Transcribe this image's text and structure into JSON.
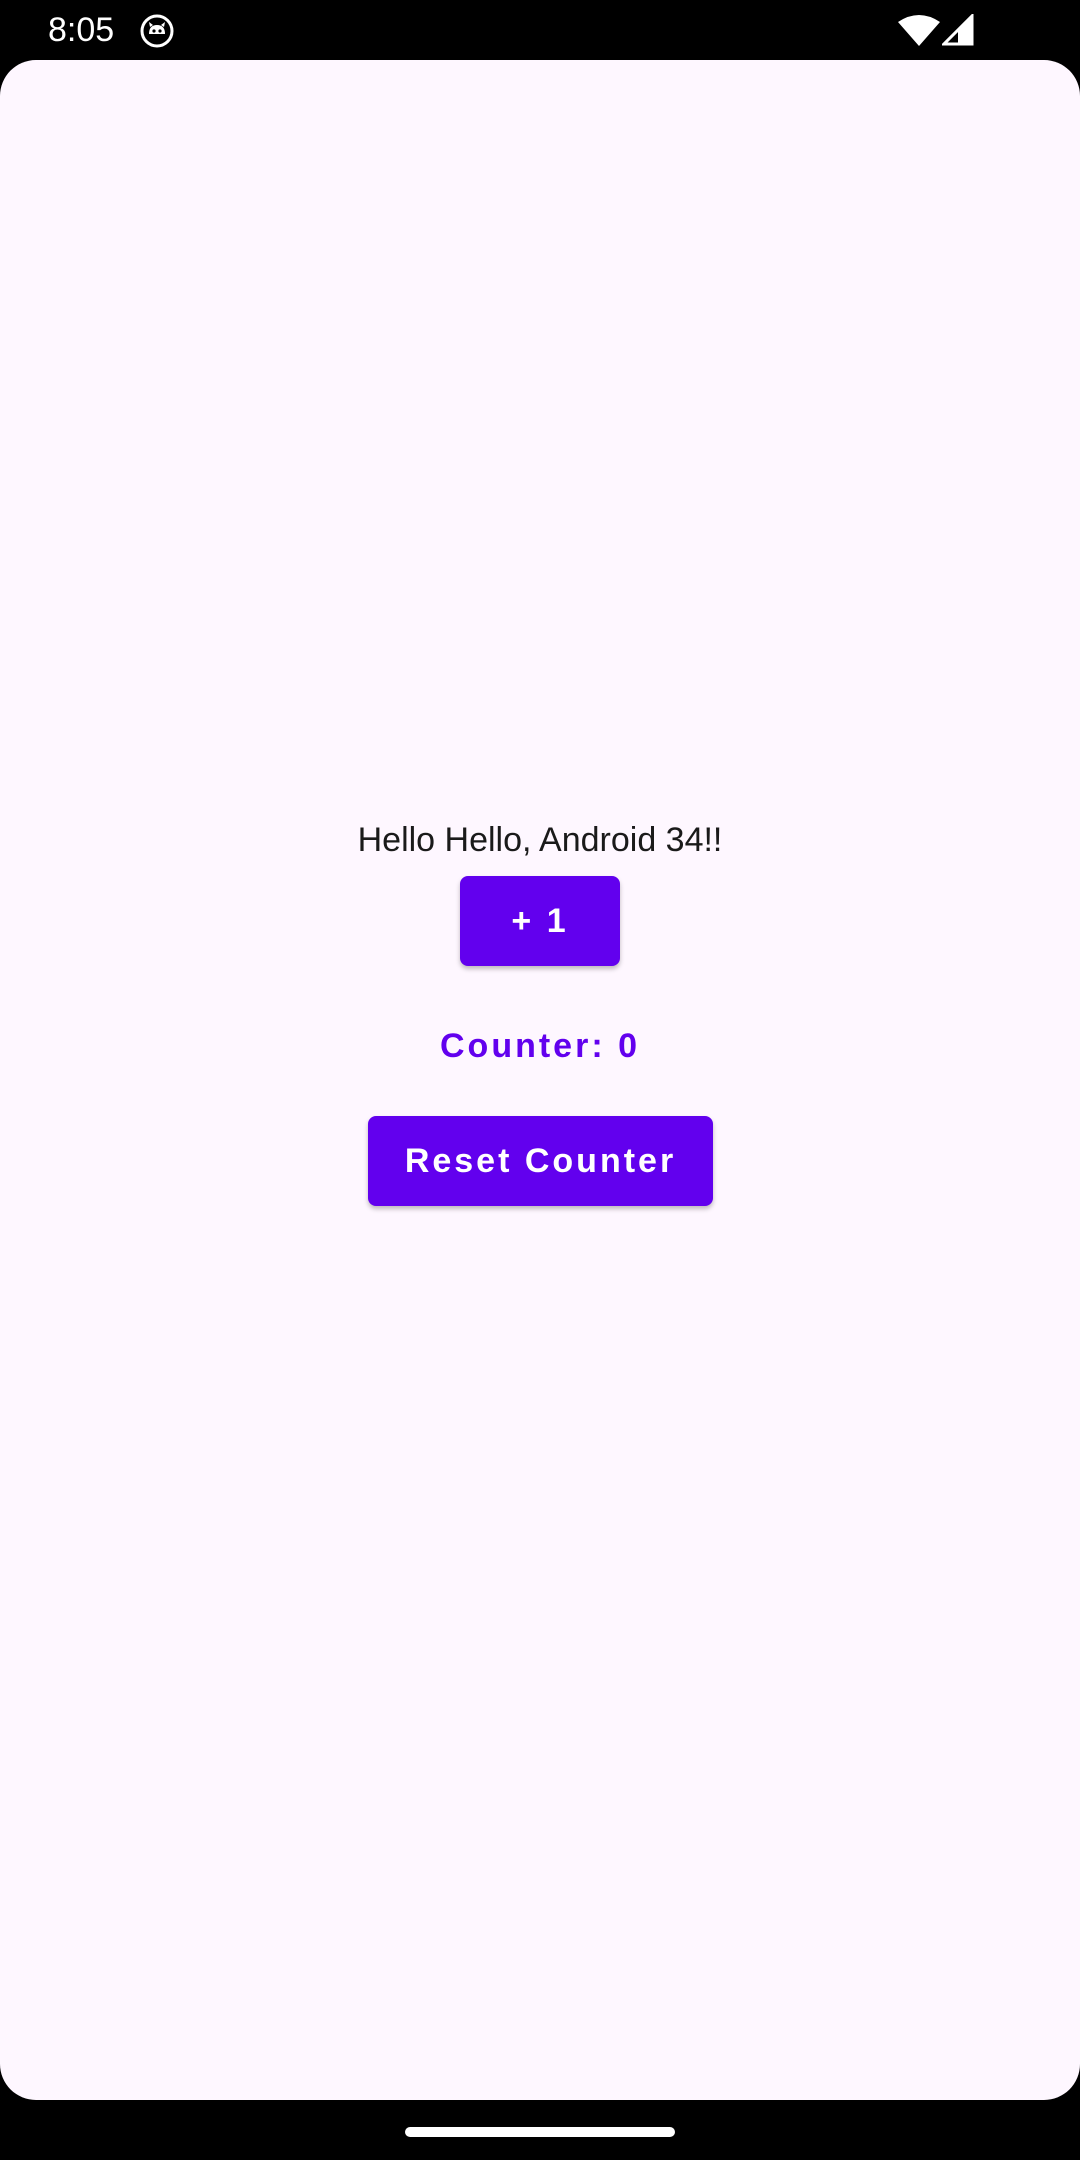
{
  "status_bar": {
    "time": "8:05",
    "app_icon": "android-cat-icon",
    "wifi_icon": "wifi-icon",
    "signal_icon": "cell-signal-icon"
  },
  "main": {
    "greeting": "Hello Hello, Android 34!!",
    "increment_button_label": "+ 1",
    "counter_text": "Counter: 0",
    "reset_button_label": "Reset Counter"
  },
  "nav_bar": {
    "home_handle": "gesture-handle"
  },
  "colors": {
    "accent": "#6200EE",
    "background": "#FEF7FF",
    "text": "#1a1a1a"
  }
}
